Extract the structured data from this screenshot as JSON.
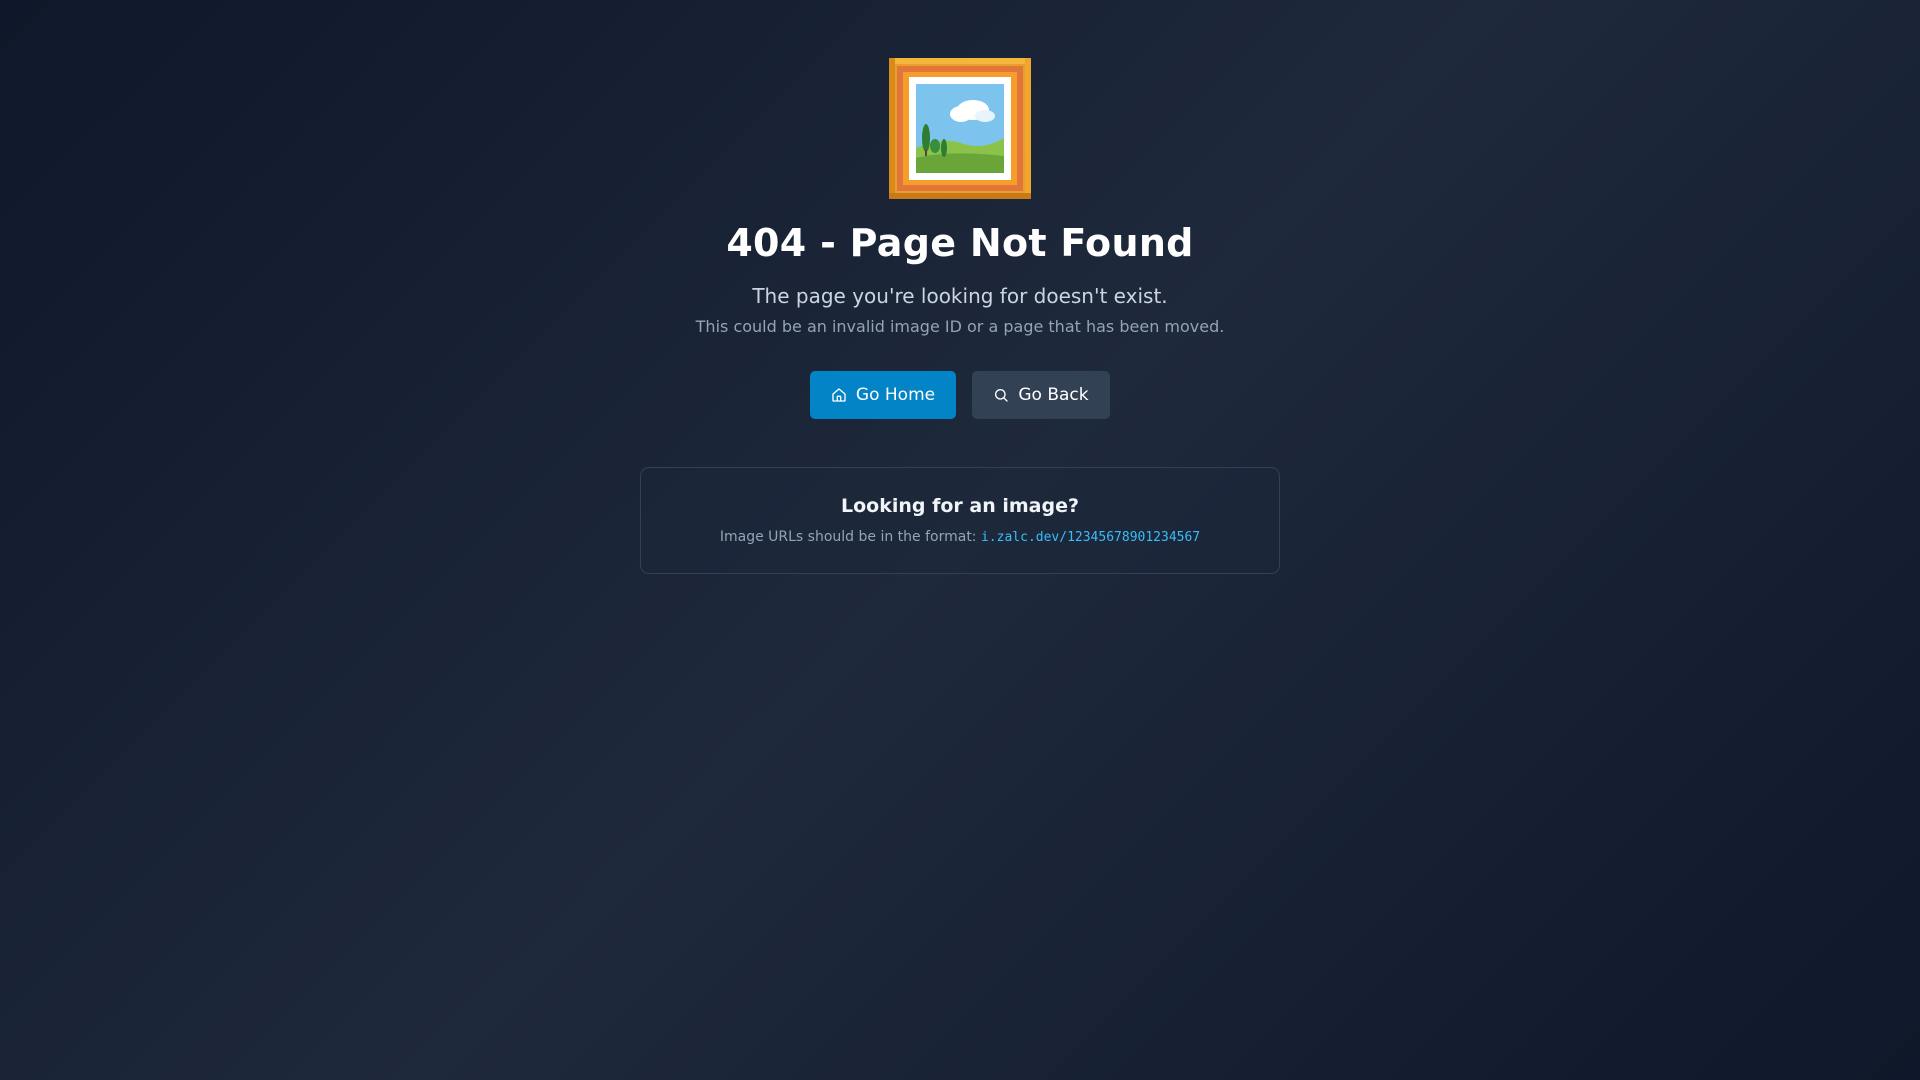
{
  "error": {
    "icon": "framed-picture-icon",
    "title": "404 - Page Not Found",
    "subtitle": "The page you're looking for doesn't exist.",
    "detail": "This could be an invalid image ID or a page that has been moved."
  },
  "actions": {
    "home_label": "Go Home",
    "home_icon": "home-icon",
    "back_label": "Go Back",
    "back_icon": "search-icon"
  },
  "hint": {
    "title": "Looking for an image?",
    "text": "Image URLs should be in the format: ",
    "format": "i.zalc.dev/12345678901234567"
  },
  "colors": {
    "background": "#0f172a",
    "primary_button": "#0284c7",
    "secondary_button": "#334155",
    "code_accent": "#38bdf8"
  }
}
